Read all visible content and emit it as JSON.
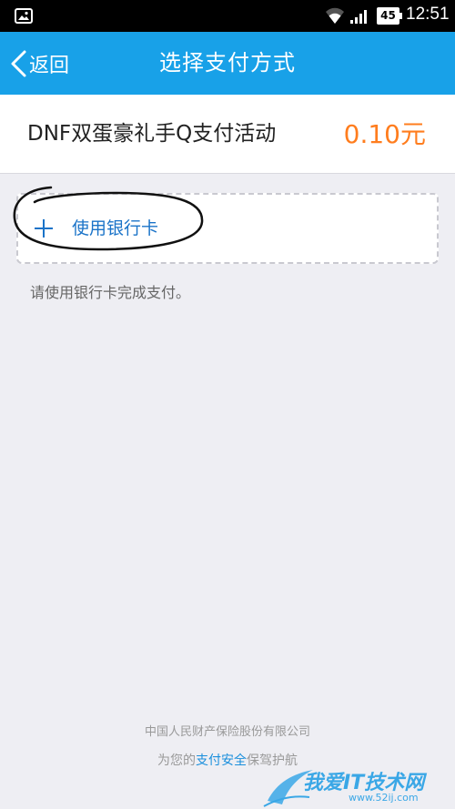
{
  "status_bar": {
    "battery_level": "45",
    "time": "12:51"
  },
  "nav": {
    "back_label": "返回",
    "title": "选择支付方式"
  },
  "product": {
    "name": "DNF双蛋豪礼手Q支付活动",
    "price": "0.10元"
  },
  "payment": {
    "add_card_label": "使用银行卡",
    "hint": "请使用银行卡完成支付。"
  },
  "footer": {
    "company": "中国人民财产保险股份有限公司",
    "security_prefix": "为您的",
    "security_highlight": "支付安全",
    "security_suffix": "保驾护航"
  },
  "watermark": {
    "main": "我爱IT技术网",
    "url": "www.52ij.com"
  },
  "colors": {
    "nav_bg": "#18a1e8",
    "price": "#ff7d1e",
    "link": "#1a73c8",
    "page_bg": "#eeeef3"
  }
}
